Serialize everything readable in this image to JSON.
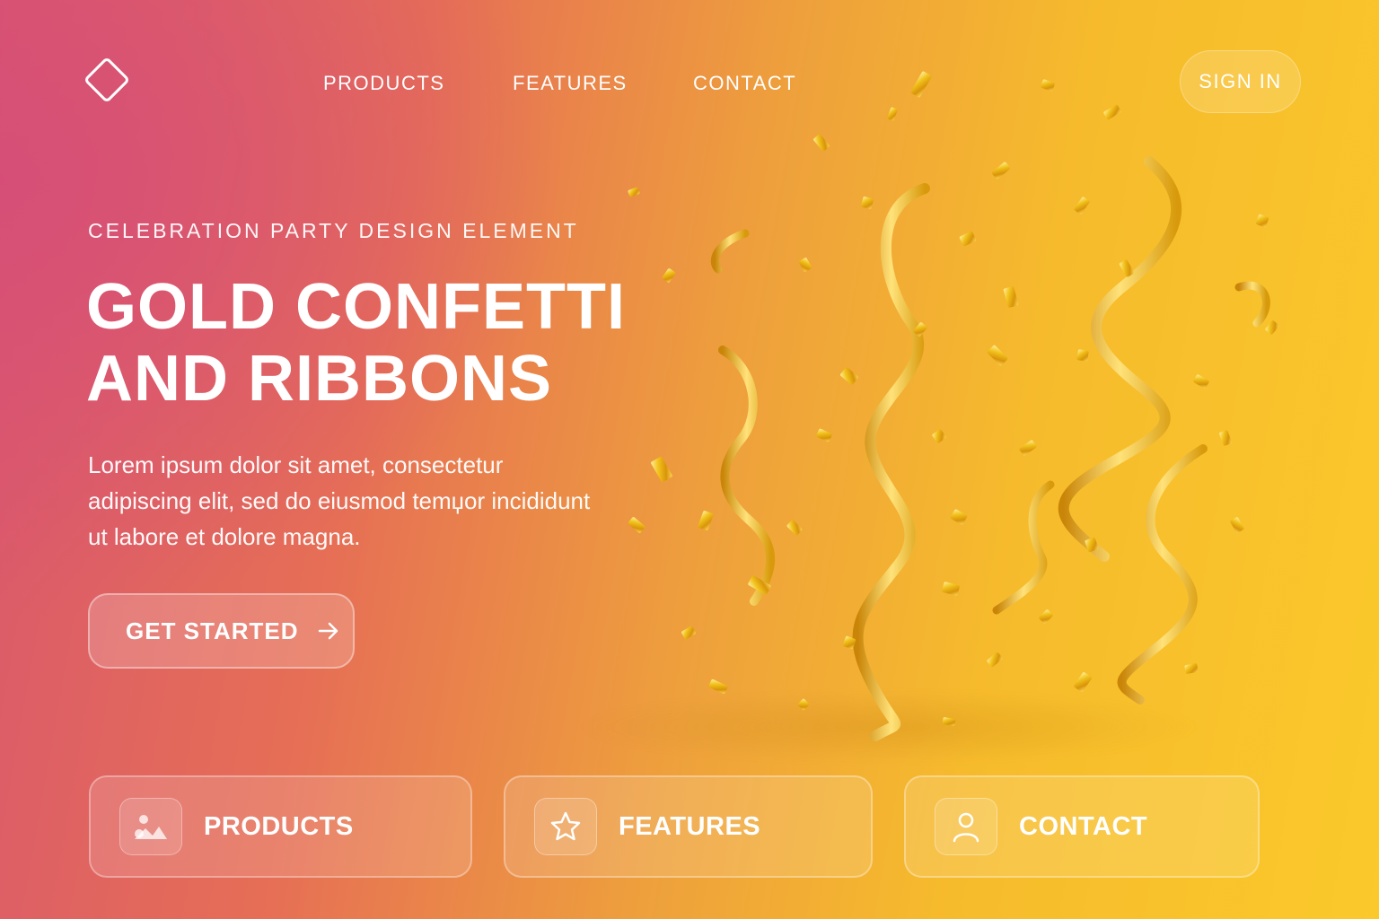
{
  "header": {
    "nav": [
      "PRODUCTS",
      "FEATURES",
      "CONTACT"
    ],
    "signin_label": "SIGN IN"
  },
  "hero": {
    "eyebrow": "CELEBRATION PARTY DESIGN ELEMENT",
    "title_line1": "GOLD CONFETTI",
    "title_line2": "AND RIBBONS",
    "description": "Lorem ipsum dolor sit amet, consectetur adipiscing elit, sed do eiusmod temџor incididunt ut labore et dolore magna.",
    "cta_label": "GET STARTED"
  },
  "cards": [
    {
      "label": "PRODUCTS",
      "icon": "image-icon"
    },
    {
      "label": "FEATURES",
      "icon": "star-icon"
    },
    {
      "label": "CONTACT",
      "icon": "user-icon"
    }
  ],
  "colors": {
    "gradient_left": "#d9566e",
    "gradient_mid": "#eea03c",
    "gradient_right": "#fbc92b",
    "gold": "#e8a90e"
  }
}
